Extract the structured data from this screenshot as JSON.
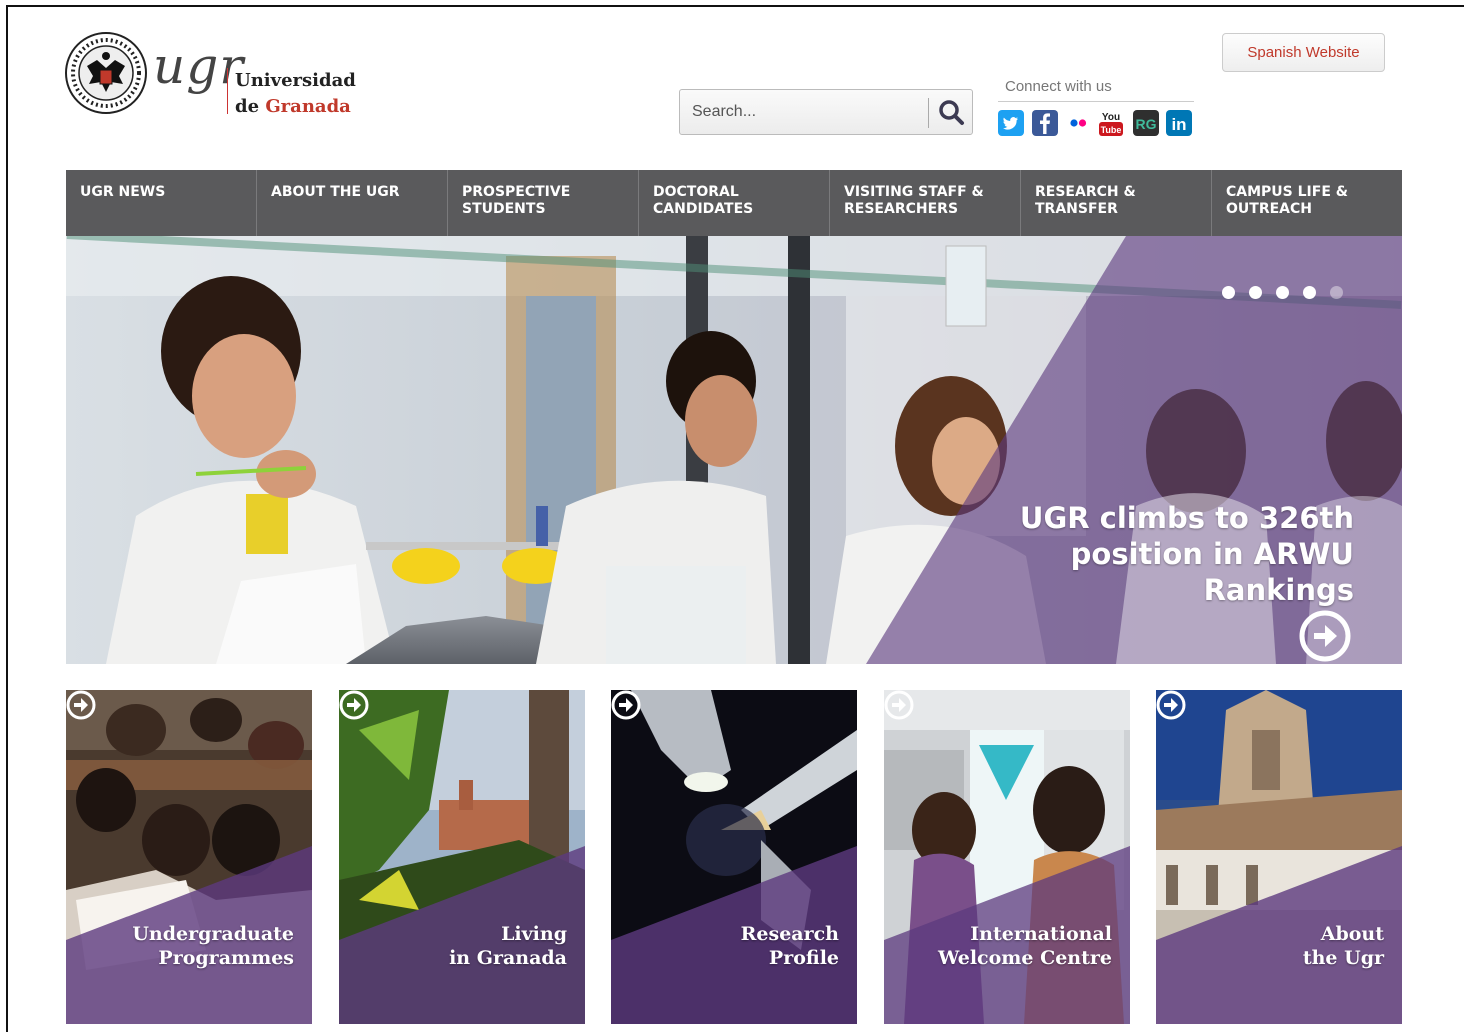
{
  "header": {
    "logo": {
      "mark": "ugr",
      "line1": "Universidad",
      "line2_prefix": "de ",
      "line2_highlight": "Granada"
    },
    "search": {
      "placeholder": "Search..."
    },
    "connect_label": "Connect with us",
    "social": [
      {
        "name": "twitter",
        "glyph": "t",
        "color": "#1da1f2"
      },
      {
        "name": "facebook",
        "glyph": "f",
        "color": "#3b5998"
      },
      {
        "name": "flickr",
        "glyph": "••",
        "color": "#ffffff"
      },
      {
        "name": "youtube",
        "glyph": "You",
        "color": "#cc181e"
      },
      {
        "name": "researchgate",
        "glyph": "RG",
        "color": "#40ba9b"
      },
      {
        "name": "linkedin",
        "glyph": "in",
        "color": "#0077b5"
      }
    ],
    "spanish_button": "Spanish Website"
  },
  "nav": {
    "items": [
      "UGR NEWS",
      "ABOUT THE UGR",
      "PROSPECTIVE\nSTUDENTS",
      "DOCTORAL\nCANDIDATES",
      "VISITING STAFF &\nRESEARCHERS",
      "RESEARCH &\nTRANSFER",
      "CAMPUS LIFE &\nOUTREACH"
    ]
  },
  "hero": {
    "title": "UGR climbs to 326th\nposition in ARWU\nRankings",
    "slides_total": 5,
    "active_slide": 5,
    "accent": "#5c3a7e"
  },
  "tiles": [
    {
      "label": "Undergraduate\nProgrammes"
    },
    {
      "label": "Living\nin Granada"
    },
    {
      "label": "Research\nProfile"
    },
    {
      "label": "International\nWelcome Centre"
    },
    {
      "label": "About\nthe Ugr"
    }
  ]
}
